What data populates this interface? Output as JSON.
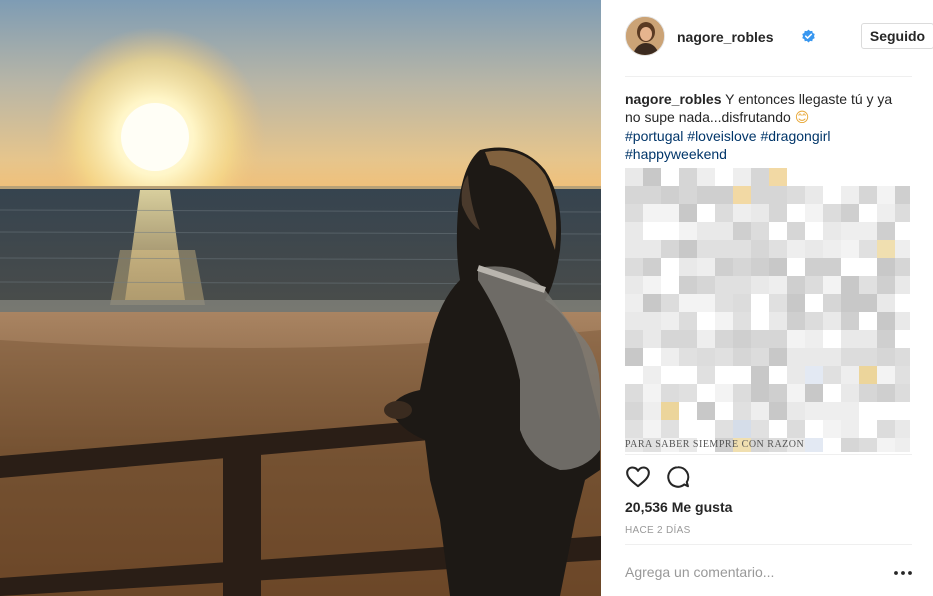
{
  "post": {
    "photo_alt_icon": "beach-sunset-photo",
    "author": {
      "username": "nagore_robles",
      "verified": true,
      "follow_label": "Seguido"
    },
    "caption": {
      "username": "nagore_robles",
      "text": "Y entonces llegaste tú y ya no supe nada...disfrutando",
      "emoji": "😊",
      "hashtags": [
        "#portugal",
        "#loveislove",
        "#dragongirl",
        "#happyweekend"
      ]
    },
    "comments_hidden_line": "PARA SABER SIEMPRE CON RAZON",
    "actions": {
      "like_icon": "heart-icon",
      "comment_icon": "comment-bubble-icon",
      "more_icon": "ellipsis-icon"
    },
    "likes_text": "20,536 Me gusta",
    "timestamp": "HACE 2 DÍAS",
    "comment_placeholder": "Agrega un comentario...",
    "more_label": "•••"
  },
  "colors": {
    "link": "#003569",
    "verified_badge": "#3897f0",
    "divider": "#efefef",
    "muted": "#999999"
  }
}
